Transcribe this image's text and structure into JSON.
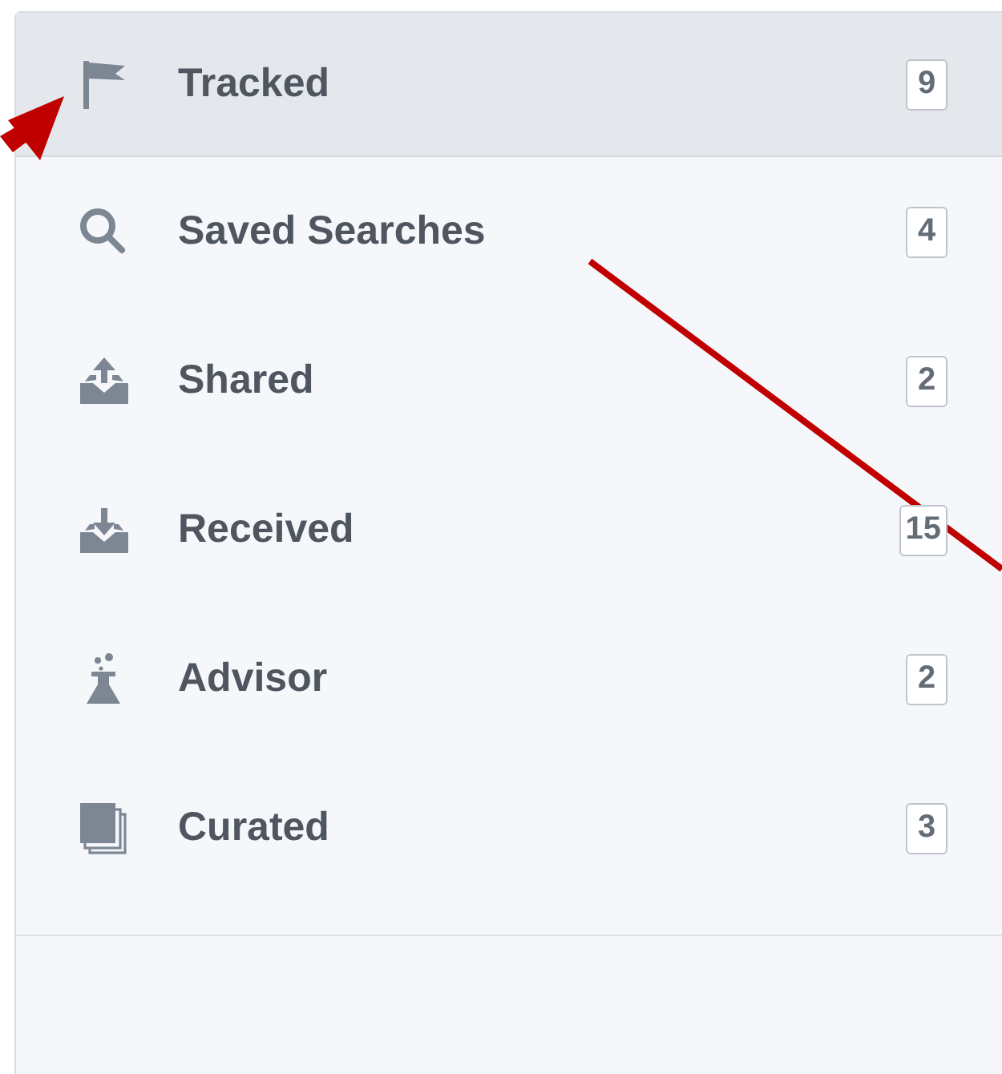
{
  "sidebar": {
    "items": [
      {
        "kind": "flag",
        "label": "Tracked",
        "count": "9",
        "selected": true
      },
      {
        "kind": "search",
        "label": "Saved Searches",
        "count": "4",
        "selected": false
      },
      {
        "kind": "upload",
        "label": "Shared",
        "count": "2",
        "selected": false
      },
      {
        "kind": "download",
        "label": "Received",
        "count": "15",
        "selected": false
      },
      {
        "kind": "flask",
        "label": "Advisor",
        "count": "2",
        "selected": false
      },
      {
        "kind": "stack",
        "label": "Curated",
        "count": "3",
        "selected": false
      }
    ]
  }
}
